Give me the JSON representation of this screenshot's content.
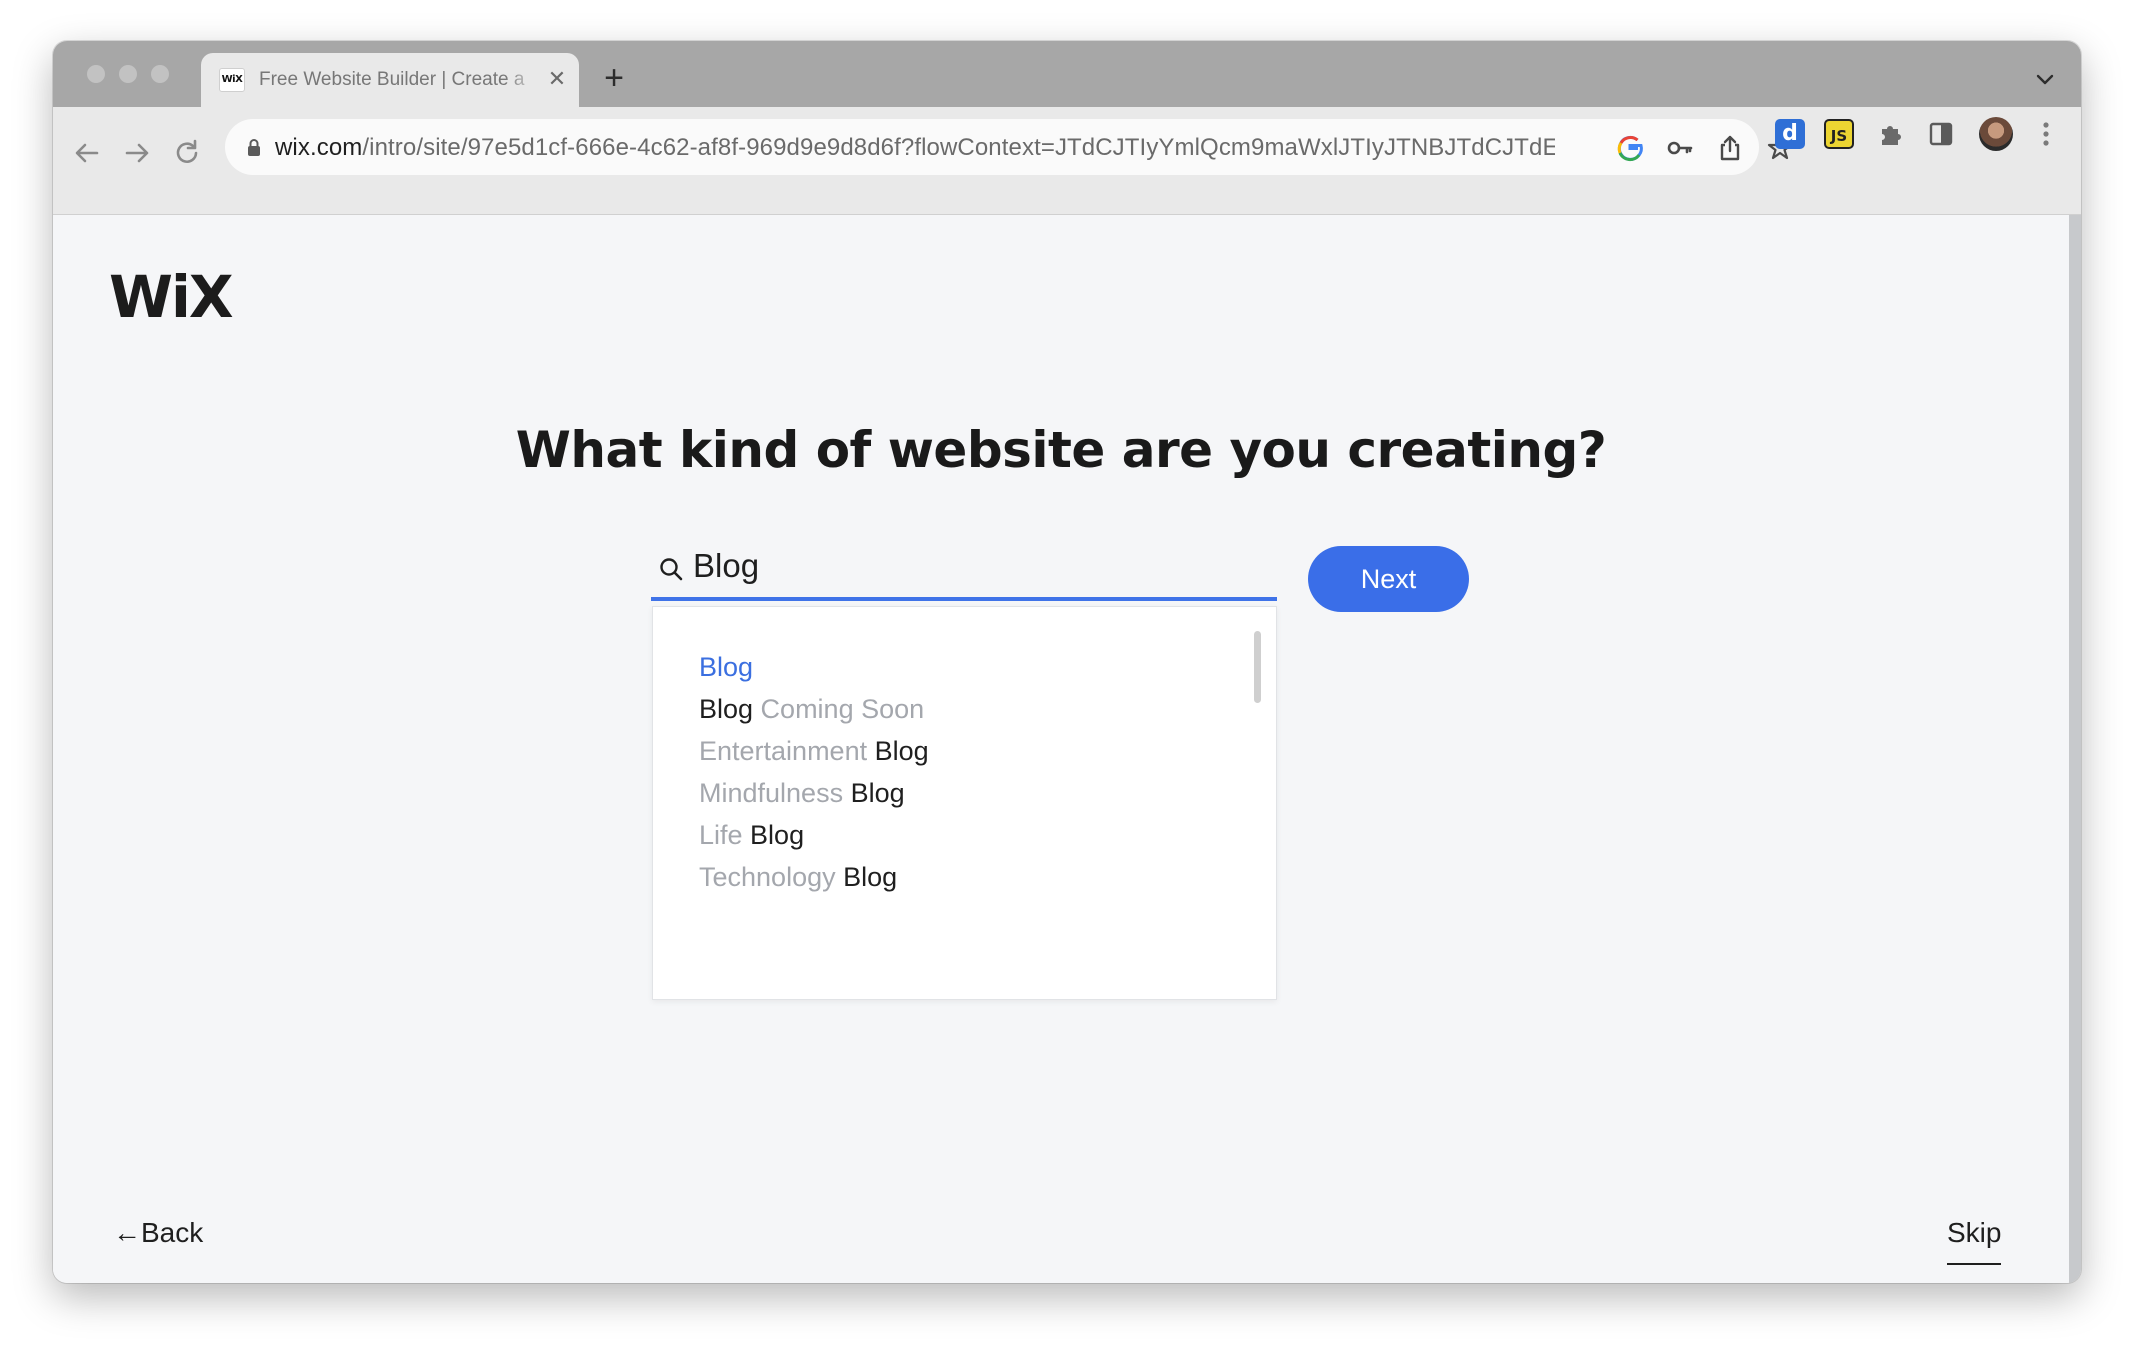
{
  "browser": {
    "tab": {
      "favicon_text": "WiX",
      "title": "Free Website Builder | Create a",
      "close": "✕"
    },
    "new_tab": "+",
    "url_host": "wix.com",
    "url_path": "/intro/site/97e5d1cf-666e-4c62-af8f-969d9e9d8d6f?flowContext=JTdCJTIyYmlQcm9maWxlJTIyJTNBJTdCJTdE...",
    "extensions": {
      "d_label": "d",
      "js_label": "JS"
    }
  },
  "page": {
    "logo": "WiX",
    "heading": "What kind of website are you creating?",
    "search": {
      "value": "Blog"
    },
    "next_label": "Next",
    "suggestions": [
      {
        "prefix": "",
        "strong": "Blog",
        "suffix": ""
      },
      {
        "prefix": "",
        "strong": "Blog",
        "suffix": " Coming Soon"
      },
      {
        "prefix": "Entertainment ",
        "strong": "Blog",
        "suffix": ""
      },
      {
        "prefix": "Mindfulness ",
        "strong": "Blog",
        "suffix": ""
      },
      {
        "prefix": "Life ",
        "strong": "Blog",
        "suffix": ""
      },
      {
        "prefix": "Technology ",
        "strong": "Blog",
        "suffix": ""
      }
    ],
    "back_label": "←Back",
    "skip_label": "Skip"
  }
}
